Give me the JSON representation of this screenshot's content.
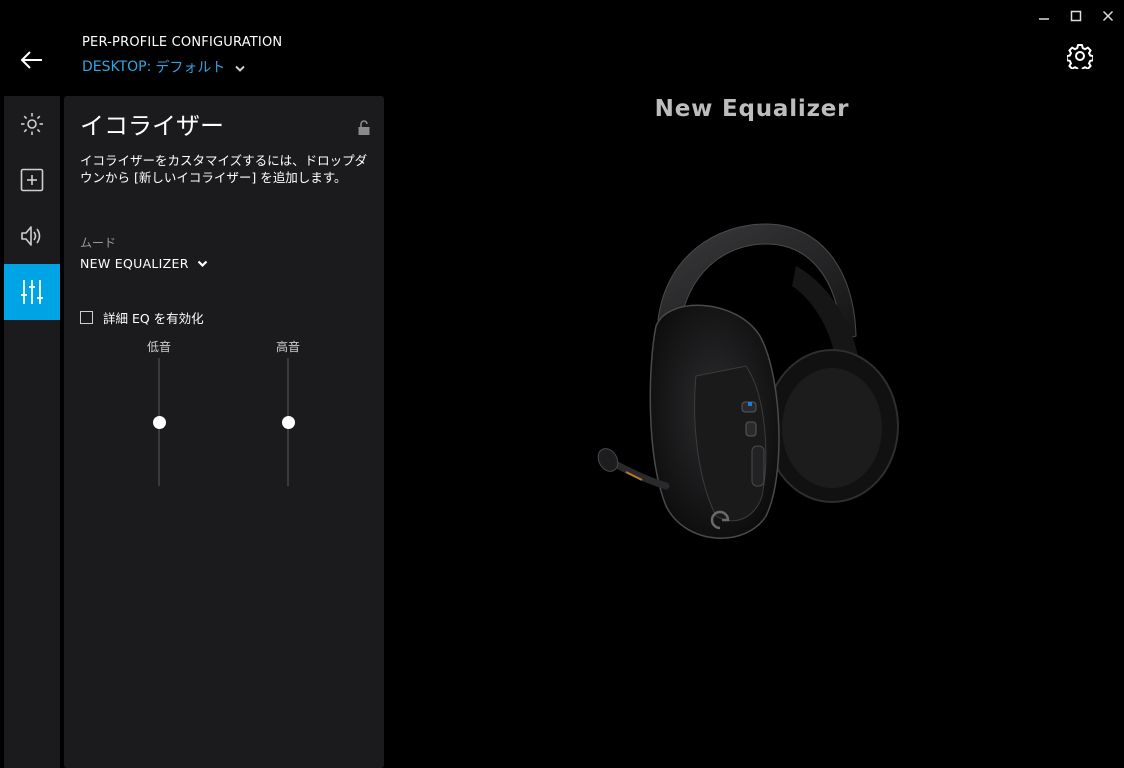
{
  "window": {
    "controls": [
      "minimize-icon",
      "maximize-icon",
      "close-icon"
    ]
  },
  "header": {
    "title": "PER-PROFILE CONFIGURATION",
    "profile_label": "DESKTOP:",
    "profile_value": "デフォルト"
  },
  "sidebar": {
    "items": [
      {
        "icon": "lighting-icon",
        "active": false
      },
      {
        "icon": "assignments-icon",
        "active": false
      },
      {
        "icon": "acoustics-icon",
        "active": false
      },
      {
        "icon": "equalizer-icon",
        "active": true
      }
    ]
  },
  "panel": {
    "title": "イコライザー",
    "description": "イコライザーをカスタマイズするには、ドロップダウンから [新しいイコライザー] を追加します。",
    "mode_label": "ムード",
    "mode_value": "NEW EQUALIZER",
    "advanced_eq_label": "詳細 EQ を有効化",
    "advanced_eq_checked": false,
    "sliders": [
      {
        "label": "低音",
        "level": 0.5
      },
      {
        "label": "高音",
        "level": 0.5
      }
    ]
  },
  "main": {
    "equalizer_name": "New Equalizer",
    "device_image": "headset-image"
  },
  "colors": {
    "accent": "#00a4e4",
    "accent_text": "#2fa6e2",
    "background": "#000000",
    "panel": "#1b1b1d"
  }
}
